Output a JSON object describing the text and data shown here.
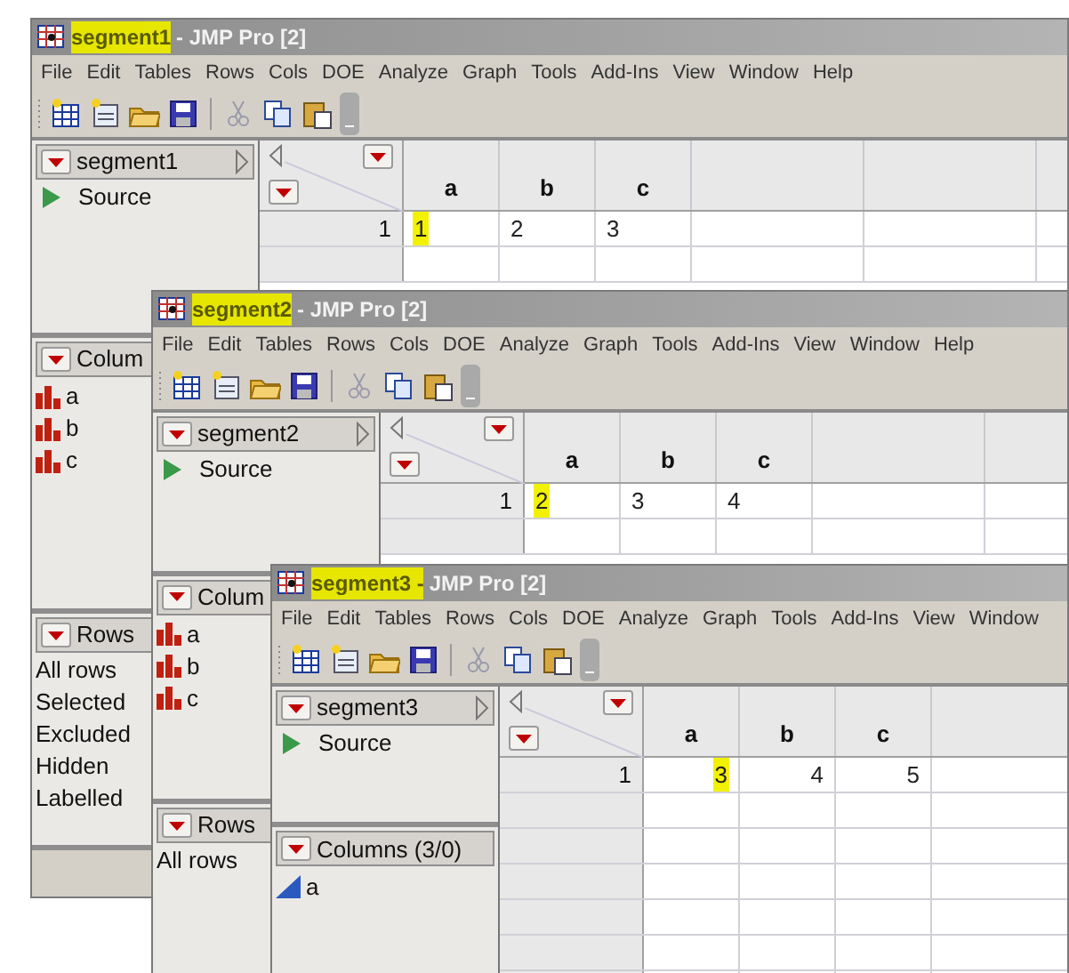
{
  "windows": [
    {
      "title": {
        "name": "segment1",
        "suffix": "- JMP Pro [2]",
        "highlighted": true
      },
      "menus": [
        "File",
        "Edit",
        "Tables",
        "Rows",
        "Cols",
        "DOE",
        "Analyze",
        "Graph",
        "Tools",
        "Add-Ins",
        "View",
        "Window",
        "Help"
      ],
      "table_panel": {
        "name": "segment1",
        "items": [
          "Source"
        ]
      },
      "columns_panel": {
        "header": "Colum",
        "columns": [
          {
            "name": "a",
            "kind": "nominal"
          },
          {
            "name": "b",
            "kind": "nominal"
          },
          {
            "name": "c",
            "kind": "nominal"
          }
        ]
      },
      "rows_panel": {
        "header": "Rows",
        "items": [
          "All rows",
          "Selected",
          "Excluded",
          "Hidden",
          "Labelled"
        ]
      },
      "grid": {
        "columns": [
          {
            "name": "a",
            "kind": "nominal"
          },
          {
            "name": "b",
            "kind": "nominal"
          },
          {
            "name": "c",
            "kind": "nominal"
          }
        ],
        "rows": [
          {
            "number": "1",
            "cells": [
              {
                "value": "1",
                "highlighted": true
              },
              {
                "value": "2",
                "highlighted": false
              },
              {
                "value": "3",
                "highlighted": false
              }
            ]
          }
        ]
      }
    },
    {
      "title": {
        "name": "segment2",
        "suffix": "- JMP Pro [2]",
        "highlighted": true
      },
      "menus": [
        "File",
        "Edit",
        "Tables",
        "Rows",
        "Cols",
        "DOE",
        "Analyze",
        "Graph",
        "Tools",
        "Add-Ins",
        "View",
        "Window",
        "Help"
      ],
      "table_panel": {
        "name": "segment2",
        "items": [
          "Source"
        ]
      },
      "columns_panel": {
        "header": "Colum",
        "columns": [
          {
            "name": "a",
            "kind": "nominal"
          },
          {
            "name": "b",
            "kind": "nominal"
          },
          {
            "name": "c",
            "kind": "nominal"
          }
        ]
      },
      "rows_panel": {
        "header": "Rows",
        "items": [
          "All rows"
        ]
      },
      "grid": {
        "columns": [
          {
            "name": "a",
            "kind": "nominal"
          },
          {
            "name": "b",
            "kind": "nominal"
          },
          {
            "name": "c",
            "kind": "nominal"
          }
        ],
        "rows": [
          {
            "number": "1",
            "cells": [
              {
                "value": "2",
                "highlighted": true
              },
              {
                "value": "3",
                "highlighted": false
              },
              {
                "value": "4",
                "highlighted": false
              }
            ]
          }
        ]
      }
    },
    {
      "title": {
        "name": "segment3 -",
        "suffix": "JMP Pro [2]",
        "highlighted": true
      },
      "menus": [
        "File",
        "Edit",
        "Tables",
        "Rows",
        "Cols",
        "DOE",
        "Analyze",
        "Graph",
        "Tools",
        "Add-Ins",
        "View",
        "Window"
      ],
      "table_panel": {
        "name": "segment3",
        "items": [
          "Source"
        ]
      },
      "columns_panel": {
        "header": "Columns (3/0)",
        "columns": [
          {
            "name": "a",
            "kind": "continuous"
          }
        ]
      },
      "grid": {
        "columns": [
          {
            "name": "a",
            "kind": "continuous"
          },
          {
            "name": "b",
            "kind": "continuous"
          },
          {
            "name": "c",
            "kind": "continuous"
          }
        ],
        "rows": [
          {
            "number": "1",
            "cells": [
              {
                "value": "3",
                "highlighted": true
              },
              {
                "value": "4",
                "highlighted": false
              },
              {
                "value": "5",
                "highlighted": false
              }
            ]
          }
        ]
      }
    }
  ]
}
